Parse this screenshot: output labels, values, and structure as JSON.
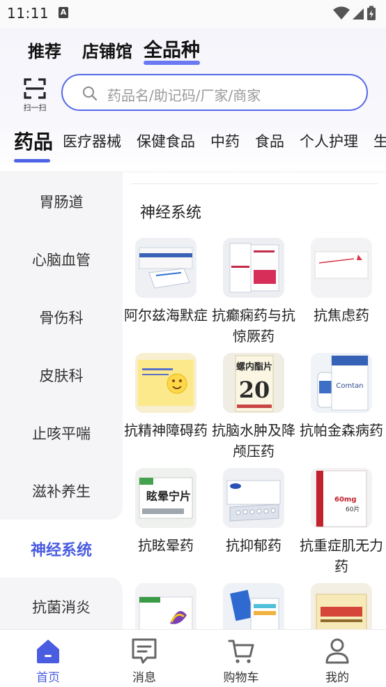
{
  "status_bar": {
    "time": "11:11",
    "badge": "A"
  },
  "top_tabs": [
    {
      "label": "推荐"
    },
    {
      "label": "店铺馆"
    },
    {
      "label": "全品种"
    }
  ],
  "scan": {
    "label": "扫一扫",
    "icon": "scan-icon"
  },
  "search": {
    "placeholder": "药品名/助记码/厂家/商家",
    "icon": "search-icon"
  },
  "category_tabs": [
    {
      "label": "药品"
    },
    {
      "label": "医疗器械"
    },
    {
      "label": "保健食品"
    },
    {
      "label": "中药"
    },
    {
      "label": "食品"
    },
    {
      "label": "个人护理"
    },
    {
      "label": "生活"
    }
  ],
  "sidebar": {
    "items": [
      {
        "label": "胃肠道"
      },
      {
        "label": "心脑血管"
      },
      {
        "label": "骨伤科"
      },
      {
        "label": "皮肤科"
      },
      {
        "label": "止咳平喘"
      },
      {
        "label": "滋补养生"
      },
      {
        "label": "神经系统"
      },
      {
        "label": "抗菌消炎"
      }
    ],
    "active_index": 6
  },
  "main": {
    "section_title": "神经系统",
    "items": [
      {
        "label": "阿尔兹海默症"
      },
      {
        "label": "抗癫痫药与抗惊厥药"
      },
      {
        "label": "抗焦虑药"
      },
      {
        "label": "抗精神障碍药"
      },
      {
        "label": "抗脑水肿及降颅压药"
      },
      {
        "label": "抗帕金森病药"
      },
      {
        "label": "抗眩晕药"
      },
      {
        "label": "抗抑郁药"
      },
      {
        "label": "抗重症肌无力药"
      },
      {
        "label": ""
      },
      {
        "label": ""
      },
      {
        "label": ""
      }
    ],
    "thumb_texts": [
      "螺内酯片",
      "20",
      "Comtan",
      "眩晕宁片",
      "60mg",
      "60片"
    ]
  },
  "bottom_nav": [
    {
      "label": "首页",
      "icon": "home-icon"
    },
    {
      "label": "消息",
      "icon": "message-icon"
    },
    {
      "label": "购物车",
      "icon": "cart-icon"
    },
    {
      "label": "我的",
      "icon": "profile-icon"
    }
  ],
  "colors": {
    "accent": "#4a5de0",
    "search_border": "#5468e8",
    "sidebar_bg": "#f5f5f7"
  }
}
